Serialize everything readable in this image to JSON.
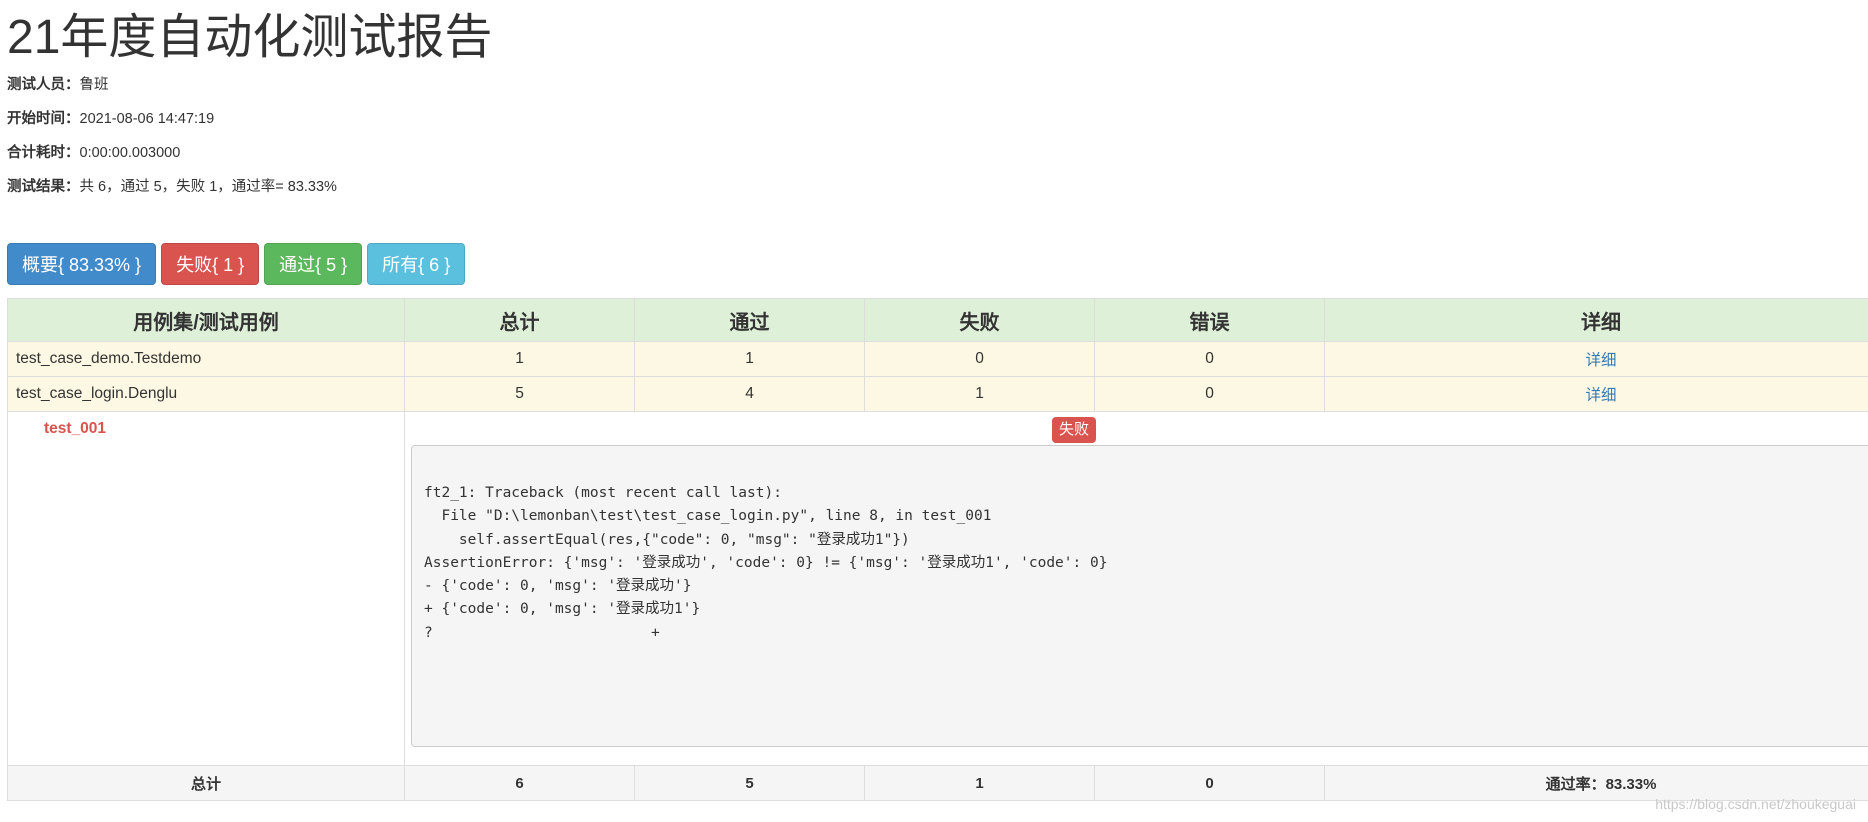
{
  "title": "21年度自动化测试报告",
  "info": {
    "tester_label": "测试人员：",
    "tester": "鲁班",
    "start_label": "开始时间：",
    "start": "2021-08-06 14:47:19",
    "duration_label": "合计耗时：",
    "duration": "0:00:00.003000",
    "result_label": "测试结果：",
    "result": "共 6，通过 5，失败 1，通过率= 83.33%"
  },
  "buttons": {
    "summary": "概要{ 83.33% }",
    "failed": "失败{ 1 }",
    "passed": "通过{ 5 }",
    "all": "所有{ 6 }"
  },
  "colors": {
    "summary": "#428bca",
    "failed": "#d9534f",
    "passed": "#5cb85c",
    "all": "#5bc0de"
  },
  "table": {
    "headers": [
      "用例集/测试用例",
      "总计",
      "通过",
      "失败",
      "错误",
      "详细"
    ],
    "rows": [
      {
        "name": "test_case_demo.Testdemo",
        "total": "1",
        "pass": "1",
        "fail": "0",
        "error": "0",
        "detail": "详细"
      },
      {
        "name": "test_case_login.Denglu",
        "total": "5",
        "pass": "4",
        "fail": "1",
        "error": "0",
        "detail": "详细"
      }
    ],
    "case": {
      "name": "test_001",
      "status": "失败",
      "traceback": "ft2_1: Traceback (most recent call last):\n  File \"D:\\lemonban\\test\\test_case_login.py\", line 8, in test_001\n    self.assertEqual(res,{\"code\": 0, \"msg\": \"登录成功1\"})\nAssertionError: {'msg': '登录成功', 'code': 0} != {'msg': '登录成功1', 'code': 0}\n- {'code': 0, 'msg': '登录成功'}\n+ {'code': 0, 'msg': '登录成功1'}\n?                         +"
    },
    "totals": {
      "label": "总计",
      "total": "6",
      "pass": "5",
      "fail": "1",
      "error": "0",
      "rate": "通过率：83.33%"
    }
  },
  "watermark": "https://blog.csdn.net/zhoukeguai"
}
